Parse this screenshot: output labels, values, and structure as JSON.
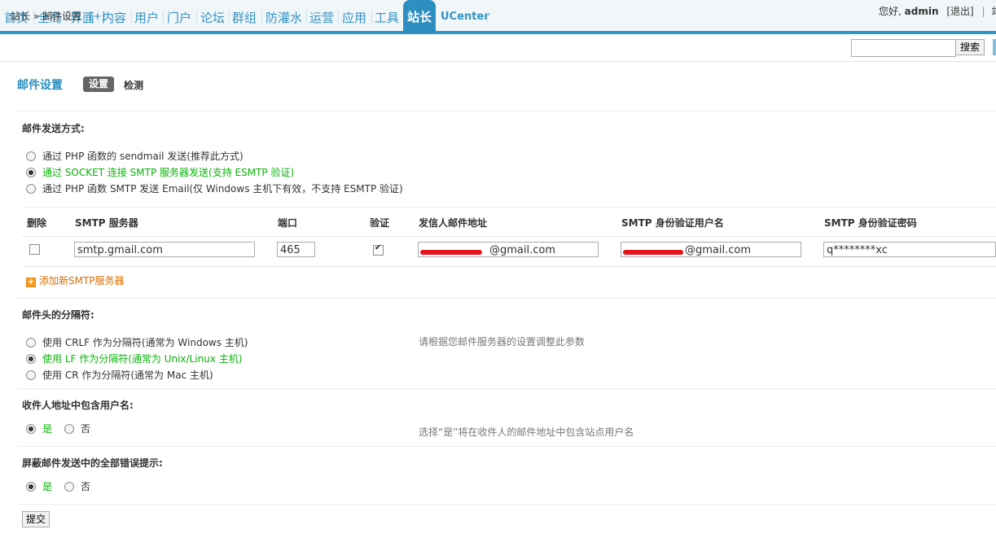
{
  "nav": {
    "items": [
      "首页",
      "全局",
      "界面",
      "内容",
      "用户",
      "门户",
      "论坛",
      "群组",
      "防灌水",
      "运营",
      "应用",
      "工具"
    ],
    "active": "站长",
    "ucenter": "UCenter",
    "greeting": "您好,",
    "username": "admin",
    "logout": "[退出]",
    "extra": "站"
  },
  "breadcrumb": {
    "root": "站长",
    "sep": "»",
    "current": "邮件设置",
    "add": "[+]"
  },
  "search": {
    "button": "搜索",
    "value": ""
  },
  "page": {
    "title": "邮件设置",
    "tabs": [
      "设置",
      "检测"
    ]
  },
  "mail_method": {
    "label": "邮件发送方式:",
    "options": [
      "通过 PHP 函数的 sendmail 发送(推荐此方式)",
      "通过 SOCKET 连接 SMTP 服务器发送(支持 ESMTP 验证)",
      "通过 PHP 函数 SMTP 发送 Email(仅 Windows 主机下有效，不支持 ESMTP 验证)"
    ],
    "selected_index": 1
  },
  "smtp_table": {
    "headers": [
      "删除",
      "SMTP 服务器",
      "端口",
      "验证",
      "发信人邮件地址",
      "SMTP 身份验证用户名",
      "SMTP 身份验证密码"
    ],
    "row": {
      "delete": false,
      "server": "smtp.gmail.com",
      "port": "465",
      "auth": true,
      "from": "@gmail.com",
      "username": "@gmail.com",
      "password": "q********xc"
    },
    "add_label": "添加新SMTP服务器"
  },
  "separator": {
    "label": "邮件头的分隔符:",
    "options": [
      "使用 CRLF 作为分隔符(通常为 Windows 主机)",
      "使用 LF 作为分隔符(通常为 Unix/Linux 主机)",
      "使用 CR 作为分隔符(通常为 Mac 主机)"
    ],
    "selected_index": 1,
    "hint": "请根据您邮件服务器的设置调整此参数"
  },
  "include_username": {
    "label": "收件人地址中包含用户名:",
    "yes": "是",
    "no": "否",
    "selected": "yes",
    "hint": "选择“是”将在收件人的邮件地址中包含站点用户名"
  },
  "silent_errors": {
    "label": "屏蔽邮件发送中的全部错误提示:",
    "yes": "是",
    "no": "否",
    "selected": "yes"
  },
  "submit": "提交"
}
